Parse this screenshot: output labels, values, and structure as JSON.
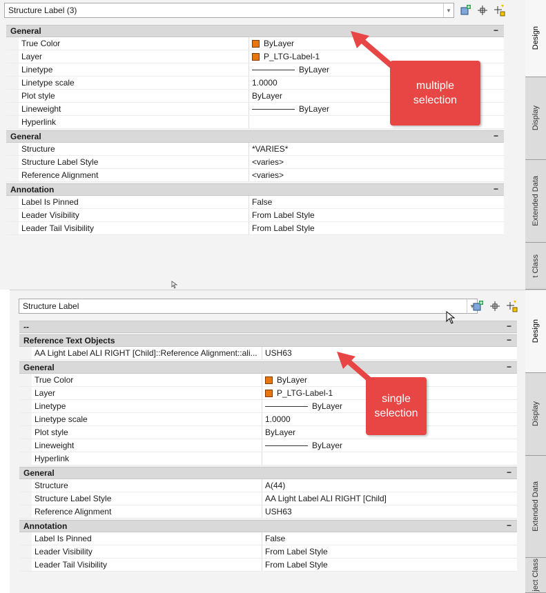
{
  "top": {
    "selector": "Structure Label (3)",
    "categories": [
      {
        "name": "General",
        "rows": [
          {
            "name": "True Color",
            "value": "ByLayer",
            "swatch": true
          },
          {
            "name": "Layer",
            "value": "P_LTG-Label-1",
            "swatch": true
          },
          {
            "name": "Linetype",
            "value": "ByLayer",
            "line": true
          },
          {
            "name": "Linetype scale",
            "value": "1.0000"
          },
          {
            "name": "Plot style",
            "value": "ByLayer"
          },
          {
            "name": "Lineweight",
            "value": "ByLayer",
            "line": true
          },
          {
            "name": "Hyperlink",
            "value": ""
          }
        ]
      },
      {
        "name": "General",
        "rows": [
          {
            "name": "Structure",
            "value": "*VARIES*"
          },
          {
            "name": "Structure Label Style",
            "value": "<varies>"
          },
          {
            "name": "Reference Alignment",
            "value": "<varies>"
          }
        ]
      },
      {
        "name": "Annotation",
        "rows": [
          {
            "name": "Label Is Pinned",
            "value": "False"
          },
          {
            "name": "Leader Visibility",
            "value": "From Label Style"
          },
          {
            "name": "Leader Tail Visibility",
            "value": "From Label Style"
          }
        ]
      }
    ],
    "tabs": [
      "Design",
      "Display",
      "Extended Data",
      "t Class"
    ],
    "callout": "multiple\nselection"
  },
  "bottom": {
    "selector": "Structure Label",
    "categories": [
      {
        "name": "--",
        "rows": []
      },
      {
        "name": "Reference Text Objects",
        "rows": [
          {
            "name": "AA Light Label ALI RIGHT [Child]::Reference Alignment::ali...",
            "value": "USH63"
          }
        ]
      },
      {
        "name": "General",
        "rows": [
          {
            "name": "True Color",
            "value": "ByLayer",
            "swatch": true
          },
          {
            "name": "Layer",
            "value": "P_LTG-Label-1",
            "swatch": true
          },
          {
            "name": "Linetype",
            "value": "ByLayer",
            "line": true
          },
          {
            "name": "Linetype scale",
            "value": "1.0000"
          },
          {
            "name": "Plot style",
            "value": "ByLayer"
          },
          {
            "name": "Lineweight",
            "value": "ByLayer",
            "line": true
          },
          {
            "name": "Hyperlink",
            "value": ""
          }
        ]
      },
      {
        "name": "General",
        "rows": [
          {
            "name": "Structure",
            "value": "A(44)"
          },
          {
            "name": "Structure Label Style",
            "value": "AA Light Label ALI RIGHT [Child]"
          },
          {
            "name": "Reference Alignment",
            "value": "USH63"
          }
        ]
      },
      {
        "name": "Annotation",
        "rows": [
          {
            "name": "Label Is Pinned",
            "value": "False"
          },
          {
            "name": "Leader Visibility",
            "value": "From Label Style"
          },
          {
            "name": "Leader Tail Visibility",
            "value": "From Label Style"
          }
        ]
      }
    ],
    "tabs": [
      "Design",
      "Display",
      "Extended Data",
      "ject Class"
    ],
    "callout": "single\nselection"
  },
  "collapse_glyph": "−",
  "icons": [
    "quick-select-icon",
    "select-objects-icon",
    "toggle-pickadd-icon"
  ],
  "colors": {
    "swatch": "#e8760c",
    "callout": "#e84545",
    "category_bg": "#d9d9d9"
  }
}
